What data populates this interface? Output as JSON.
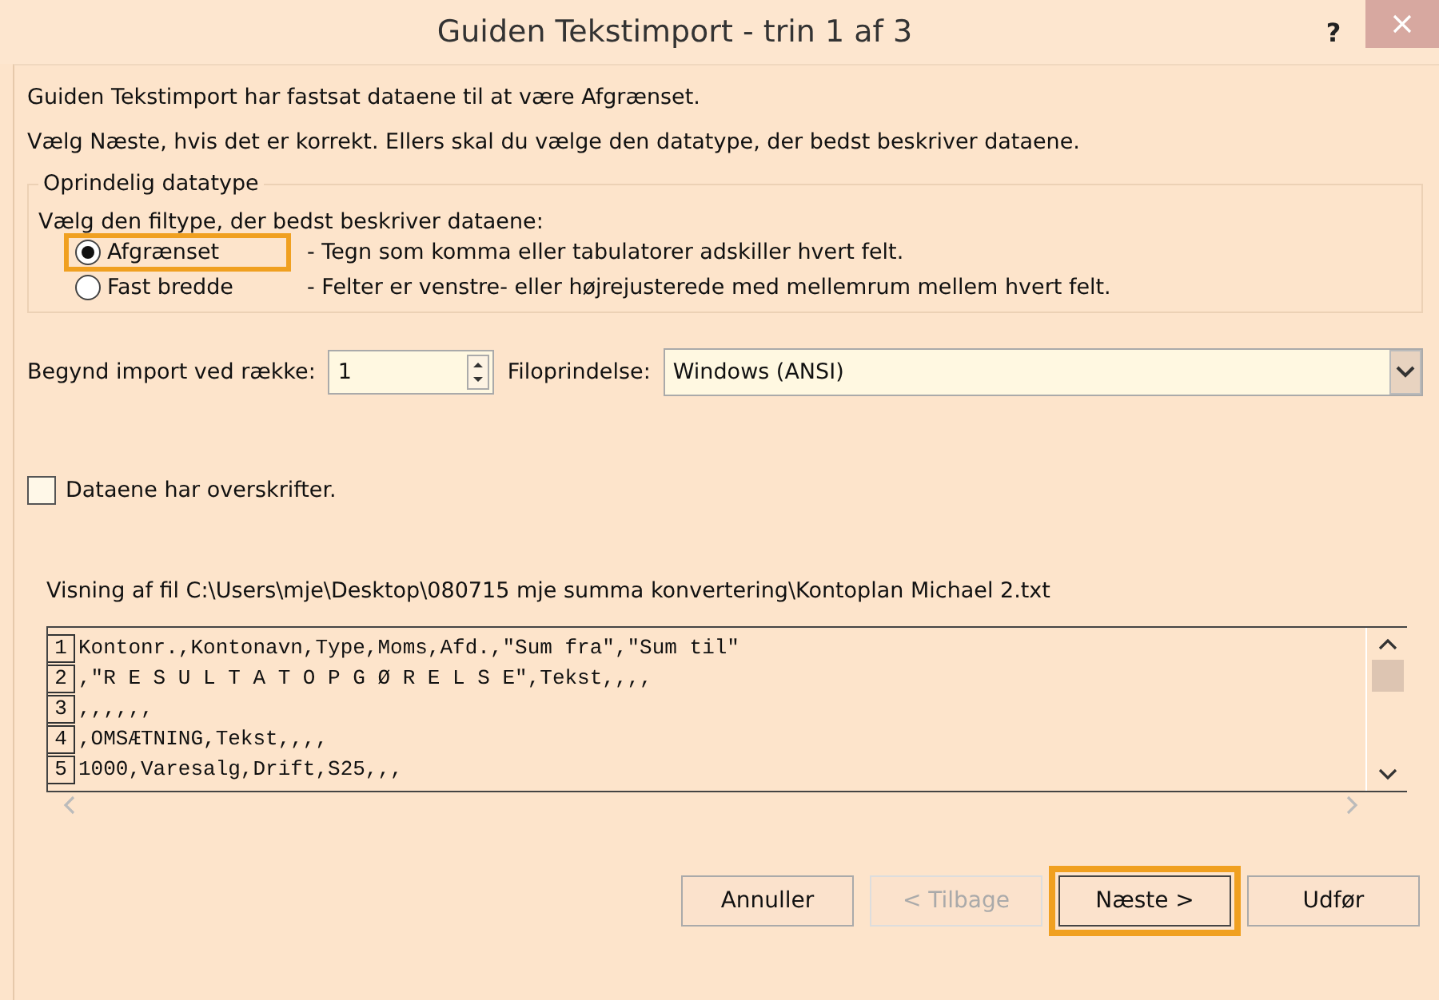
{
  "window": {
    "title": "Guiden Tekstimport - trin 1 af 3",
    "help": "?"
  },
  "intro": [
    "Guiden Tekstimport har fastsat dataene til at være Afgrænset.",
    "Vælg Næste, hvis det er korrekt. Ellers skal du vælge den datatype, der bedst beskriver dataene."
  ],
  "datatype": {
    "legend": "Oprindelig datatype",
    "prompt": "Vælg den filtype, der bedst beskriver dataene:",
    "options": [
      {
        "label": "Afgrænset",
        "description": "- Tegn som komma eller tabulatorer adskiller hvert felt.",
        "selected": true,
        "highlighted": true
      },
      {
        "label": "Fast bredde",
        "description": "- Felter er venstre- eller højrejusterede med mellemrum mellem hvert felt.",
        "selected": false,
        "highlighted": false
      }
    ]
  },
  "start_row": {
    "label": "Begynd import ved række:",
    "value": "1"
  },
  "file_origin": {
    "label": "Filoprindelse:",
    "value": "Windows (ANSI)"
  },
  "headers": {
    "label": "Dataene har overskrifter.",
    "checked": false
  },
  "preview": {
    "label": "Visning af fil C:\\Users\\mje\\Desktop\\080715 mje summa konvertering\\Kontoplan Michael 2.txt",
    "lines": [
      {
        "number": "1",
        "text": "Kontonr.,Kontonavn,Type,Moms,Afd.,\"Sum fra\",\"Sum til\""
      },
      {
        "number": "2",
        "text": ",\"R E S U L T A T O P G Ø R E L S E\",Tekst,,,,"
      },
      {
        "number": "3",
        "text": ",,,,,,"
      },
      {
        "number": "4",
        "text": ",OMSÆTNING,Tekst,,,,"
      },
      {
        "number": "5",
        "text": "1000,Varesalg,Drift,S25,,,"
      }
    ]
  },
  "buttons": [
    {
      "label": "Annuller",
      "disabled": false,
      "highlighted": false
    },
    {
      "label": "< Tilbage",
      "disabled": true,
      "highlighted": false
    },
    {
      "label": "Næste >",
      "disabled": false,
      "highlighted": true
    },
    {
      "label": "Udfør",
      "disabled": false,
      "highlighted": false
    }
  ]
}
